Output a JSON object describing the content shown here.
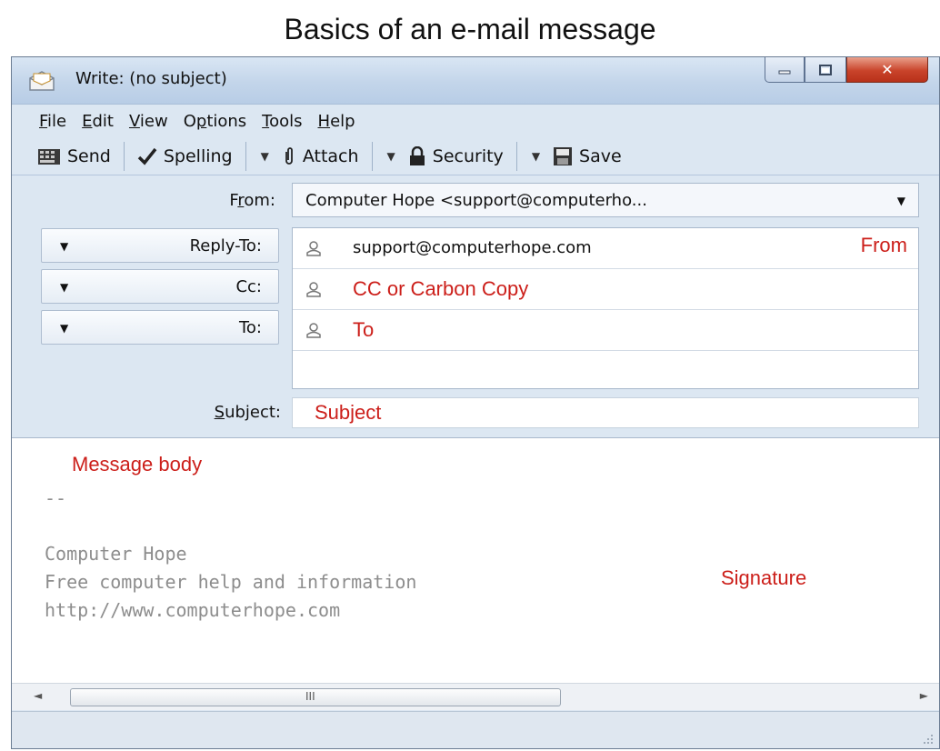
{
  "page_title": "Basics of an e-mail message",
  "window": {
    "title": "Write: (no subject)",
    "controls": [
      "minimize-icon",
      "maximize-icon",
      "close-icon"
    ]
  },
  "menu": [
    {
      "accel": "F",
      "rest": "ile"
    },
    {
      "accel": "E",
      "rest": "dit"
    },
    {
      "accel": "V",
      "rest": "iew"
    },
    {
      "pre": "O",
      "accel": "p",
      "rest": "tions"
    },
    {
      "accel": "T",
      "rest": "ools"
    },
    {
      "accel": "H",
      "rest": "elp"
    }
  ],
  "toolbar": {
    "send": "Send",
    "spelling": "Spelling",
    "attach": "Attach",
    "security": "Security",
    "save": "Save"
  },
  "from": {
    "label_pre": "F",
    "label_accel": "r",
    "label_post": "om:",
    "value": "Computer Hope <support@computerho..."
  },
  "recipient_types": [
    "Reply-To:",
    "Cc:",
    "To:"
  ],
  "recipients": [
    {
      "value": "support@computerhope.com",
      "annotation": "From"
    },
    {
      "value": "CC or Carbon Copy"
    },
    {
      "value": "To"
    }
  ],
  "subject": {
    "label_accel": "S",
    "label_rest": "ubject:",
    "value": "Subject"
  },
  "body": {
    "annotation": "Message body",
    "sig_separator": "--",
    "signature_lines": [
      "Computer Hope",
      "Free computer help and information",
      "http://www.computerhope.com"
    ],
    "signature_annotation": "Signature"
  },
  "scrollbar": {
    "left_arrow": "◄",
    "right_arrow": "►",
    "grip": "III"
  },
  "colors": {
    "annotation_red": "#cc1f1a",
    "window_frame": "#dce7f2",
    "close_button": "#c9432a"
  }
}
